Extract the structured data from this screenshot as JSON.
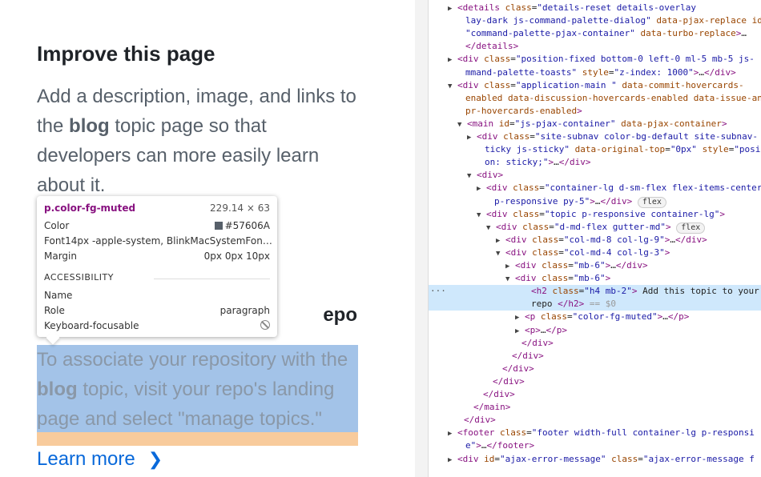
{
  "page": {
    "improve_heading": "Improve this page",
    "improve_desc_pre": "Add a description, image, and links to the ",
    "improve_desc_bold": "blog",
    "improve_desc_post": " topic page so that developers can more easily learn about it.",
    "add_topic_heading_visible": "epo",
    "para_pre": "To associate your repository with the ",
    "para_bold": "blog",
    "para_post": " topic, visit your repo's landing page and select \"manage topics.\"",
    "learn_more": "Learn more",
    "chevron_icon": "chevron-right-icon"
  },
  "tooltip": {
    "selector": "p.color-fg-muted",
    "size": "229.14 × 63",
    "color_label": "Color",
    "color_value": "#57606A",
    "font_label": "Font",
    "font_value": "14px -apple-system, BlinkMacSystemFon…",
    "margin_label": "Margin",
    "margin_value": "0px 0px 10px",
    "accessibility": "ACCESSIBILITY",
    "name_label": "Name",
    "role_label": "Role",
    "role_value": "paragraph",
    "kbd_label": "Keyboard-focusable",
    "kbd_icon": "not-focusable-icon"
  },
  "devtools": {
    "lines": [
      {
        "indent": 36,
        "tri": "▶",
        "html": "<span class='tag'>&lt;details</span> <span class='attr'>class</span>=<span class='val'>\"details-reset details-overlay</span>"
      },
      {
        "indent": 46,
        "tri": "",
        "html": "<span class='val'>lay-dark js-command-palette-dialog\"</span> <span class='attr'>data-pjax-replace</span> <span class='attr'>id</span>"
      },
      {
        "indent": 46,
        "tri": "",
        "html": "<span class='val'>\"command-palette-pjax-container\"</span> <span class='attr'>data-turbo-replace</span><span class='tag'>&gt;</span>…"
      },
      {
        "indent": 46,
        "tri": "",
        "html": "<span class='tag'>&lt;/details&gt;</span>"
      },
      {
        "indent": 36,
        "tri": "▶",
        "html": "<span class='tag'>&lt;div</span> <span class='attr'>class</span>=<span class='val'>\"position-fixed bottom-0 left-0 ml-5 mb-5 js-</span>"
      },
      {
        "indent": 46,
        "tri": "",
        "html": "<span class='val'>mmand-palette-toasts\"</span> <span class='attr'>style</span>=<span class='val'>\"z-index: 1000\"</span><span class='tag'>&gt;</span>…<span class='tag'>&lt;/div&gt;</span>"
      },
      {
        "indent": 36,
        "tri": "▼",
        "html": "<span class='tag'>&lt;div</span> <span class='attr'>class</span>=<span class='val'>\"application-main \"</span> <span class='attr'>data-commit-hovercards-</span>"
      },
      {
        "indent": 46,
        "tri": "",
        "html": "<span class='attr'>enabled data-discussion-hovercards-enabled data-issue-and</span>"
      },
      {
        "indent": 46,
        "tri": "",
        "html": "<span class='attr'>pr-hovercards-enabled</span><span class='tag'>&gt;</span>"
      },
      {
        "indent": 48,
        "tri": "▼",
        "html": "<span class='tag'>&lt;main</span> <span class='attr'>id</span>=<span class='val'>\"js-pjax-container\"</span> <span class='attr'>data-pjax-container</span><span class='tag'>&gt;</span>"
      },
      {
        "indent": 60,
        "tri": "▶",
        "html": "<span class='tag'>&lt;div</span> <span class='attr'>class</span>=<span class='val'>\"site-subnav color-bg-default site-subnav-</span>"
      },
      {
        "indent": 70,
        "tri": "",
        "html": "<span class='val'>ticky js-sticky\"</span> <span class='attr'>data-original-top</span>=<span class='val'>\"0px\"</span> <span class='attr'>style</span>=<span class='val'>\"posit</span>"
      },
      {
        "indent": 70,
        "tri": "",
        "html": "<span class='val'>on: sticky;\"</span><span class='tag'>&gt;</span>…<span class='tag'>&lt;/div&gt;</span>"
      },
      {
        "indent": 60,
        "tri": "▼",
        "html": "<span class='tag'>&lt;div&gt;</span>"
      },
      {
        "indent": 72,
        "tri": "▶",
        "html": "<span class='tag'>&lt;div</span> <span class='attr'>class</span>=<span class='val'>\"container-lg d-sm-flex flex-items-center</span>"
      },
      {
        "indent": 82,
        "tri": "",
        "html": "<span class='val'>p-responsive py-5\"</span><span class='tag'>&gt;</span>…<span class='tag'>&lt;/div&gt;</span> <span class='badge'>flex</span>"
      },
      {
        "indent": 72,
        "tri": "▼",
        "html": "<span class='tag'>&lt;div</span> <span class='attr'>class</span>=<span class='val'>\"topic p-responsive container-lg\"</span><span class='tag'>&gt;</span>"
      },
      {
        "indent": 84,
        "tri": "▼",
        "html": "<span class='tag'>&lt;div</span> <span class='attr'>class</span>=<span class='val'>\"d-md-flex gutter-md\"</span><span class='tag'>&gt;</span> <span class='badge'>flex</span>"
      },
      {
        "indent": 96,
        "tri": "▶",
        "html": "<span class='tag'>&lt;div</span> <span class='attr'>class</span>=<span class='val'>\"col-md-8 col-lg-9\"</span><span class='tag'>&gt;</span>…<span class='tag'>&lt;/div&gt;</span>"
      },
      {
        "indent": 96,
        "tri": "▼",
        "html": "<span class='tag'>&lt;div</span> <span class='attr'>class</span>=<span class='val'>\"col-md-4 col-lg-3\"</span><span class='tag'>&gt;</span>"
      },
      {
        "indent": 108,
        "tri": "▶",
        "html": "<span class='tag'>&lt;div</span> <span class='attr'>class</span>=<span class='val'>\"mb-6\"</span><span class='tag'>&gt;</span>…<span class='tag'>&lt;/div&gt;</span>"
      },
      {
        "indent": 108,
        "tri": "▼",
        "html": "<span class='tag'>&lt;div</span> <span class='attr'>class</span>=<span class='val'>\"mb-6\"</span><span class='tag'>&gt;</span>"
      },
      {
        "indent": 128,
        "tri": "",
        "sel": true,
        "html": "<span class='tag'>&lt;h2</span> <span class='attr'>class</span>=<span class='val'>\"h4 mb-2\"</span><span class='tag'>&gt;</span> Add this topic to your"
      },
      {
        "indent": 128,
        "tri": "",
        "sel": true,
        "html": "repo <span class='tag'>&lt;/h2&gt;</span> <span class='eq'>== $0</span>"
      },
      {
        "indent": 120,
        "tri": "▶",
        "html": "<span class='tag'>&lt;p</span> <span class='attr'>class</span>=<span class='val'>\"color-fg-muted\"</span><span class='tag'>&gt;</span>…<span class='tag'>&lt;/p&gt;</span>"
      },
      {
        "indent": 120,
        "tri": "▶",
        "html": "<span class='tag'>&lt;p&gt;</span>…<span class='tag'>&lt;/p&gt;</span>"
      },
      {
        "indent": 116,
        "tri": "",
        "html": "<span class='tag'>&lt;/div&gt;</span>"
      },
      {
        "indent": 104,
        "tri": "",
        "html": "<span class='tag'>&lt;/div&gt;</span>"
      },
      {
        "indent": 92,
        "tri": "",
        "html": "<span class='tag'>&lt;/div&gt;</span>"
      },
      {
        "indent": 80,
        "tri": "",
        "html": "<span class='tag'>&lt;/div&gt;</span>"
      },
      {
        "indent": 68,
        "tri": "",
        "html": "<span class='tag'>&lt;/div&gt;</span>"
      },
      {
        "indent": 56,
        "tri": "",
        "html": "<span class='tag'>&lt;/main&gt;</span>"
      },
      {
        "indent": 44,
        "tri": "",
        "html": "<span class='tag'>&lt;/div&gt;</span>"
      },
      {
        "indent": 36,
        "tri": "▶",
        "html": "<span class='tag'>&lt;footer</span> <span class='attr'>class</span>=<span class='val'>\"footer width-full container-lg p-responsi</span>"
      },
      {
        "indent": 46,
        "tri": "",
        "html": "<span class='val'>e\"</span><span class='tag'>&gt;</span>…<span class='tag'>&lt;/footer&gt;</span>"
      },
      {
        "indent": 36,
        "tri": "▶",
        "html": "<span class='tag'>&lt;div</span> <span class='attr'>id</span>=<span class='val'>\"ajax-error-message\"</span> <span class='attr'>class</span>=<span class='val'>\"ajax-error-message f</span>"
      }
    ]
  }
}
